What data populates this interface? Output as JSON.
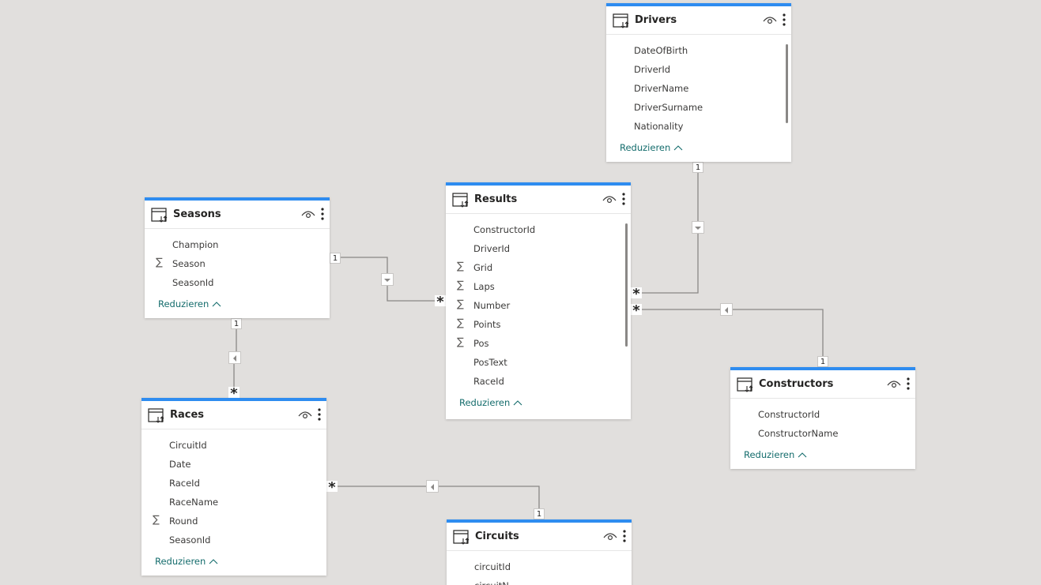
{
  "collapse_label": "Reduzieren",
  "tables": {
    "drivers": {
      "title": "Drivers",
      "fields": [
        {
          "name": "DateOfBirth",
          "sum": false
        },
        {
          "name": "DriverId",
          "sum": false
        },
        {
          "name": "DriverName",
          "sum": false
        },
        {
          "name": "DriverSurname",
          "sum": false
        },
        {
          "name": "Nationality",
          "sum": false
        }
      ]
    },
    "seasons": {
      "title": "Seasons",
      "fields": [
        {
          "name": "Champion",
          "sum": false
        },
        {
          "name": "Season",
          "sum": true
        },
        {
          "name": "SeasonId",
          "sum": false
        }
      ]
    },
    "results": {
      "title": "Results",
      "fields": [
        {
          "name": "ConstructorId",
          "sum": false
        },
        {
          "name": "DriverId",
          "sum": false
        },
        {
          "name": "Grid",
          "sum": true
        },
        {
          "name": "Laps",
          "sum": true
        },
        {
          "name": "Number",
          "sum": true
        },
        {
          "name": "Points",
          "sum": true
        },
        {
          "name": "Pos",
          "sum": true
        },
        {
          "name": "PosText",
          "sum": false
        },
        {
          "name": "RaceId",
          "sum": false
        }
      ]
    },
    "constructors": {
      "title": "Constructors",
      "fields": [
        {
          "name": "ConstructorId",
          "sum": false
        },
        {
          "name": "ConstructorName",
          "sum": false
        }
      ]
    },
    "races": {
      "title": "Races",
      "fields": [
        {
          "name": "CircuitId",
          "sum": false
        },
        {
          "name": "Date",
          "sum": false
        },
        {
          "name": "RaceId",
          "sum": false
        },
        {
          "name": "RaceName",
          "sum": false
        },
        {
          "name": "Round",
          "sum": true
        },
        {
          "name": "SeasonId",
          "sum": false
        }
      ]
    },
    "circuits": {
      "title": "Circuits",
      "fields": [
        {
          "name": "circuitId",
          "sum": false
        },
        {
          "name": "circuitN",
          "sum": false
        }
      ]
    }
  },
  "relationships": {
    "one_label": "1",
    "many_label": "*"
  },
  "colors": {
    "canvas": "#e1dfdd",
    "card_accent": "#2e8cf0",
    "collapse_link": "#146c6c",
    "line": "#8a8886"
  },
  "icons": {
    "table": "table-icon",
    "visibility": "eye-icon",
    "more": "more-options-icon",
    "sum": "sigma-icon",
    "collapse": "chevron-up-icon"
  }
}
